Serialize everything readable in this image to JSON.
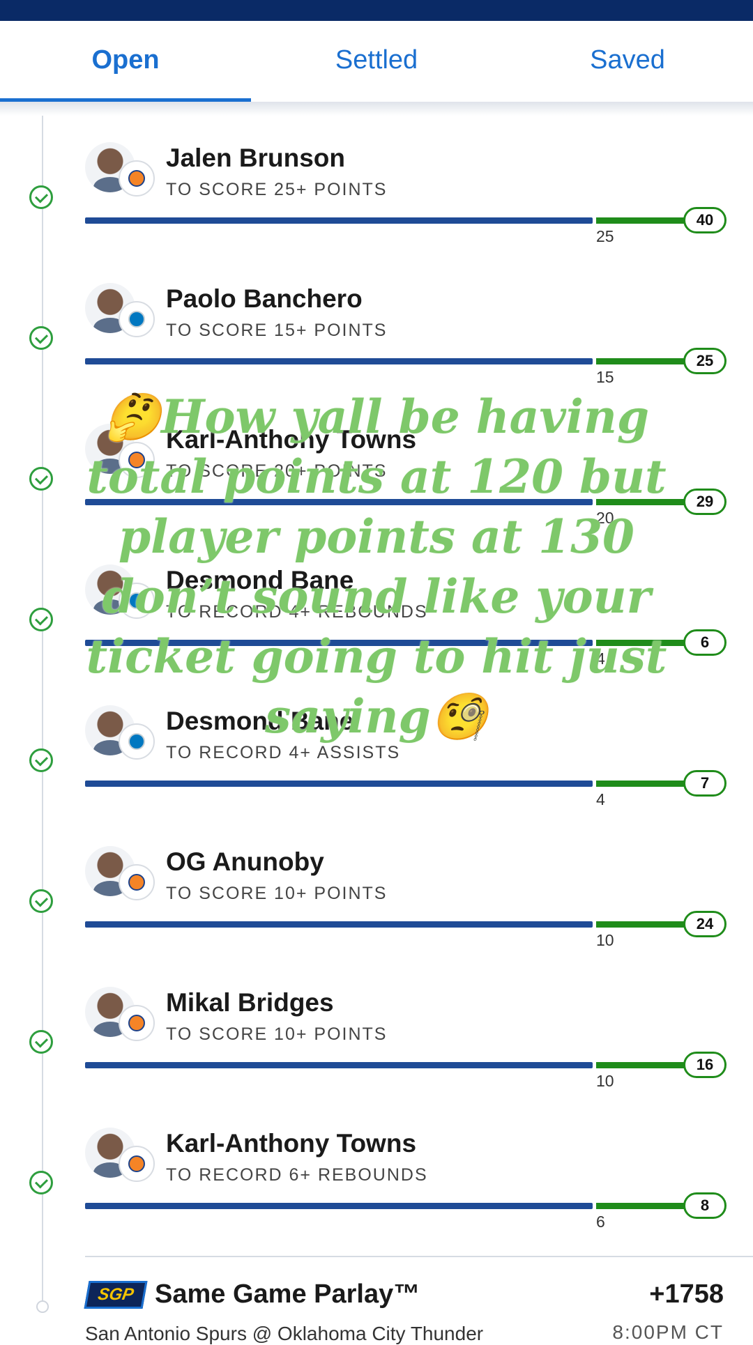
{
  "tabs": [
    {
      "label": "Open",
      "active": true
    },
    {
      "label": "Settled",
      "active": false
    },
    {
      "label": "Saved",
      "active": false
    }
  ],
  "legs": [
    {
      "player": "Jalen Brunson",
      "prop": "TO SCORE 25+ POINTS",
      "threshold": "25",
      "result": "40",
      "team": "knicks",
      "settled": "won"
    },
    {
      "player": "Paolo Banchero",
      "prop": "TO SCORE 15+ POINTS",
      "threshold": "15",
      "result": "25",
      "team": "magic",
      "settled": "won"
    },
    {
      "player": "Karl-Anthony Towns",
      "prop": "TO SCORE 20+ POINTS",
      "threshold": "20",
      "result": "29",
      "team": "knicks",
      "settled": "won"
    },
    {
      "player": "Desmond Bane",
      "prop": "TO RECORD 4+ REBOUNDS",
      "threshold": "4",
      "result": "6",
      "team": "magic",
      "settled": "won"
    },
    {
      "player": "Desmond Bane",
      "prop": "TO RECORD 4+ ASSISTS",
      "threshold": "4",
      "result": "7",
      "team": "magic",
      "settled": "won"
    },
    {
      "player": "OG Anunoby",
      "prop": "TO SCORE 10+ POINTS",
      "threshold": "10",
      "result": "24",
      "team": "knicks",
      "settled": "won"
    },
    {
      "player": "Mikal Bridges",
      "prop": "TO SCORE 10+ POINTS",
      "threshold": "10",
      "result": "16",
      "team": "knicks",
      "settled": "won"
    },
    {
      "player": "Karl-Anthony Towns",
      "prop": "TO RECORD 6+ REBOUNDS",
      "threshold": "6",
      "result": "8",
      "team": "knicks",
      "settled": "won"
    }
  ],
  "parlay": {
    "badge": "SGP",
    "title": "Same Game Parlay™",
    "odds": "+1758",
    "matchup": "San Antonio Spurs @ Oklahoma City Thunder",
    "time": "8:00PM CT"
  },
  "overlay": {
    "text": "🤔How yall be having total points at 120 but player points at 130 don’t sound like your ticket going to hit just saying🧐"
  },
  "colors": {
    "header": "#0a2a66",
    "tab_accent": "#1a6fd0",
    "progress_bar": "#1f4b96",
    "win_green": "#1f8c1a",
    "overlay_text": "#7ec86a"
  }
}
